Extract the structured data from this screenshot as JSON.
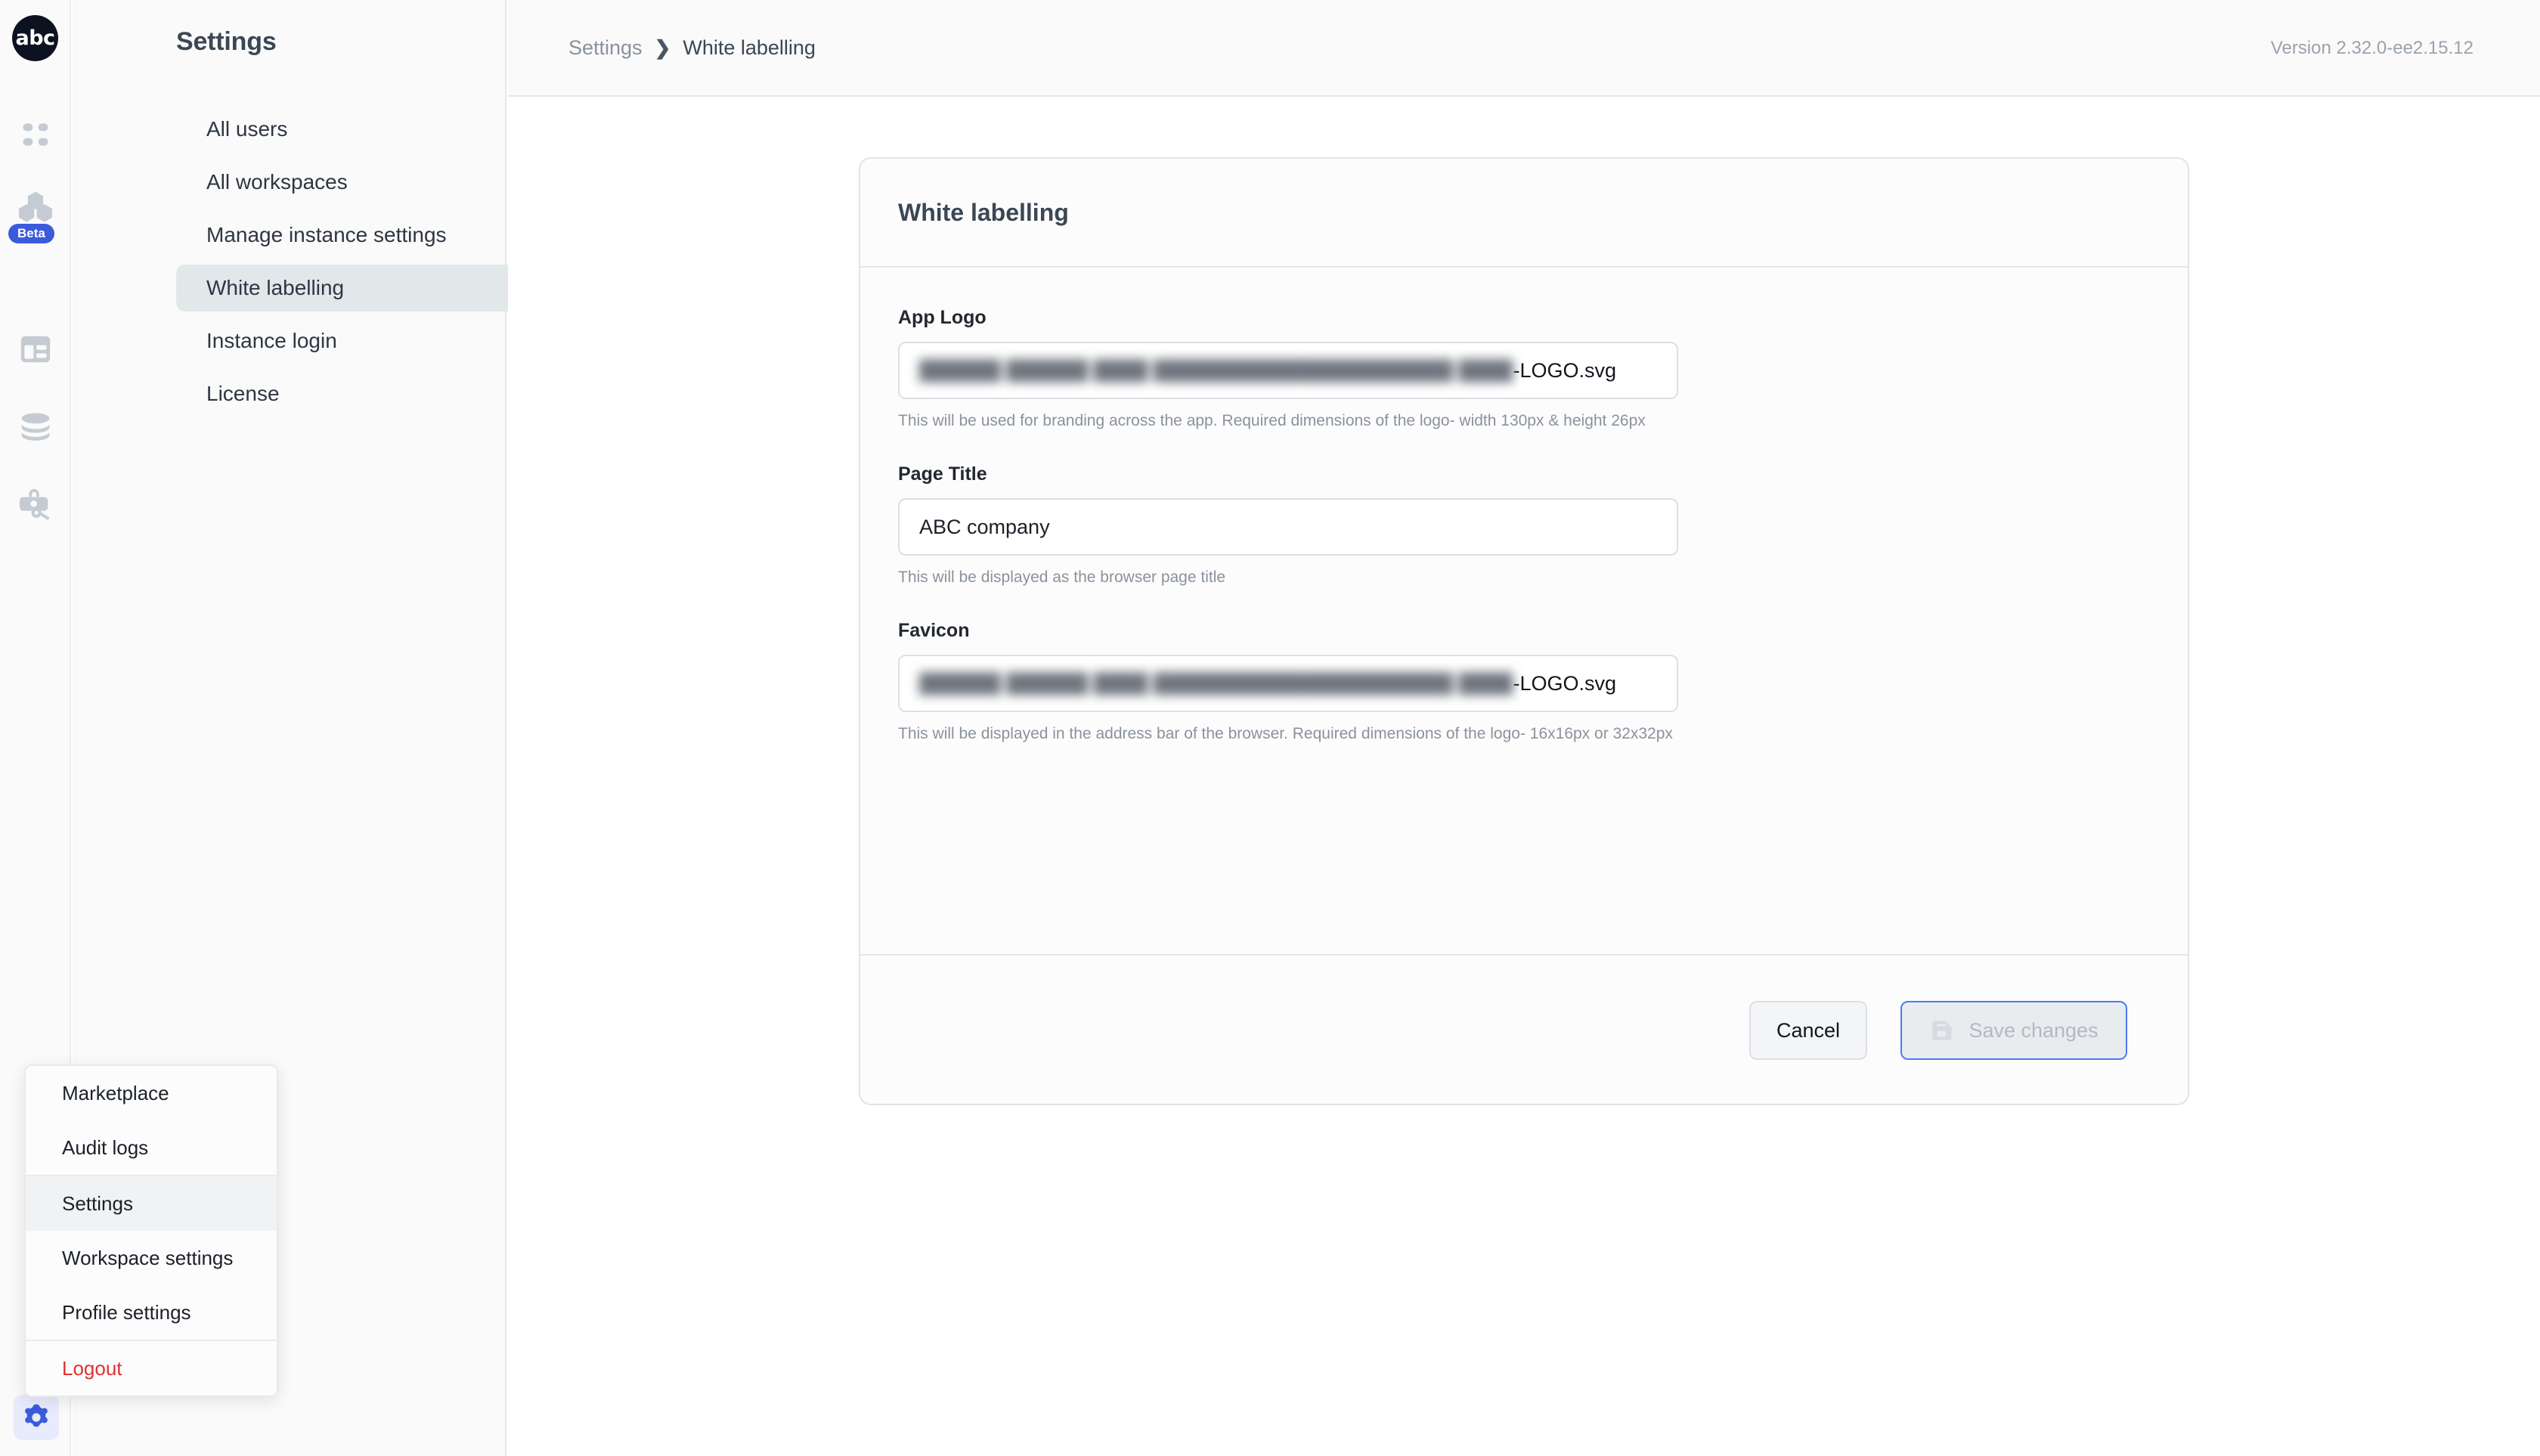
{
  "brand": {
    "logo_text": "abc",
    "beta_badge": "Beta"
  },
  "rail": {
    "icons": [
      {
        "name": "grid-dots-icon"
      },
      {
        "name": "cubes-icon"
      },
      {
        "name": "layout-panels-icon"
      },
      {
        "name": "database-stack-icon"
      },
      {
        "name": "toolbox-key-icon"
      }
    ],
    "gear": "gear-icon"
  },
  "sidebar": {
    "title": "Settings",
    "items": [
      {
        "label": "All users",
        "active": false
      },
      {
        "label": "All workspaces",
        "active": false
      },
      {
        "label": "Manage instance settings",
        "active": false
      },
      {
        "label": "White labelling",
        "active": true
      },
      {
        "label": "Instance login",
        "active": false
      },
      {
        "label": "License",
        "active": false
      }
    ]
  },
  "header": {
    "breadcrumb_root": "Settings",
    "breadcrumb_separator": "❯",
    "breadcrumb_current": "White labelling",
    "version": "Version 2.32.0-ee2.15.12"
  },
  "card": {
    "title": "White labelling",
    "fields": [
      {
        "label": "App Logo",
        "value_blurred": "██████ ██████ ████ ██████████████████████ ████",
        "value_suffix": "-LOGO.svg",
        "hint": "This will be used for branding across the app. Required dimensions of the logo- width 130px & height 26px"
      }
    ],
    "page_title_field": {
      "label": "Page Title",
      "value": "ABC company",
      "hint": "This will be displayed as the browser page title"
    },
    "favicon_field": {
      "label": "Favicon",
      "value_blurred": "██████ ██████ ████ ██████████████████████ ████",
      "value_suffix": "-LOGO.svg",
      "hint": "This will be displayed in the address bar of the browser. Required dimensions of the logo- 16x16px or 32x32px"
    },
    "cancel_label": "Cancel",
    "save_label": "Save changes",
    "save_icon": "floppy-disk-icon"
  },
  "popup_menu": {
    "groups": [
      {
        "items": [
          {
            "label": "Marketplace",
            "highlighted": false,
            "danger": false
          },
          {
            "label": "Audit logs",
            "highlighted": false,
            "danger": false
          }
        ]
      },
      {
        "items": [
          {
            "label": "Settings",
            "highlighted": true,
            "danger": false
          },
          {
            "label": "Workspace settings",
            "highlighted": false,
            "danger": false
          },
          {
            "label": "Profile settings",
            "highlighted": false,
            "danger": false
          }
        ]
      },
      {
        "items": [
          {
            "label": "Logout",
            "highlighted": false,
            "danger": true
          }
        ]
      }
    ]
  },
  "colors": {
    "accent_blue": "#3b5bdb",
    "save_border_blue": "#4b7bf5",
    "danger_red": "#e03131",
    "sidebar_bg": "#fafafa",
    "active_nav_bg": "#e2e7ea",
    "icon_gray": "#c5cbd2"
  }
}
